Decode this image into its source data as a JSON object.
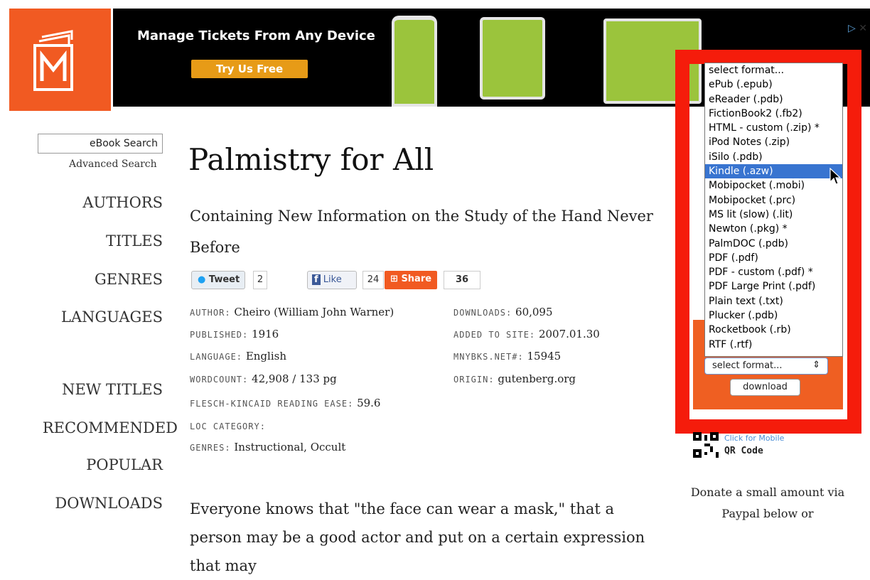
{
  "ad": {
    "title": "Manage Tickets From Any Device",
    "cta": "Try Us Free",
    "choices_label": "▷",
    "close_label": "✕"
  },
  "sidebar": {
    "search_placeholder": "eBook Search",
    "advanced_search": "Advanced Search",
    "nav": [
      "AUTHORS",
      "TITLES",
      "GENRES",
      "LANGUAGES",
      "NEW TITLES",
      "RECOMMENDED",
      "POPULAR",
      "DOWNLOADS"
    ]
  },
  "book": {
    "title": "Palmistry for All",
    "subtitle": "Containing New Information on the Study of the Hand Never Before",
    "social": {
      "tweet_label": "Tweet",
      "tweet_count": "2",
      "like_label": "Like",
      "like_count": "24",
      "share_label": "Share",
      "share_count": "36"
    },
    "meta_left": [
      {
        "key": "AUTHOR:",
        "value": "Cheiro (William John Warner)"
      },
      {
        "key": "PUBLISHED:",
        "value": "1916"
      },
      {
        "key": "LANGUAGE:",
        "value": "English"
      },
      {
        "key": "WORDCOUNT:",
        "value": "42,908 / 133 pg"
      },
      {
        "key": "FLESCH-KINCAID READING EASE:",
        "value": "59.6"
      },
      {
        "key": "LOC CATEGORY:",
        "value": ""
      },
      {
        "key": "GENRES:",
        "value": "Instructional, Occult"
      }
    ],
    "meta_right": [
      {
        "key": "DOWNLOADS:",
        "value": "60,095"
      },
      {
        "key": "ADDED TO SITE:",
        "value": "2007.01.30"
      },
      {
        "key": "MNYBKS.NET#:",
        "value": "15945"
      },
      {
        "key": "ORIGIN:",
        "value": "gutenberg.org"
      }
    ],
    "paragraph": "Everyone knows that \"the face can wear a mask,\" that a person may be a good actor and put on a certain expression that may"
  },
  "download": {
    "formats": [
      "select format...",
      "ePub (.epub)",
      "eReader (.pdb)",
      "FictionBook2 (.fb2)",
      "HTML - custom (.zip) *",
      "iPod Notes (.zip)",
      "iSilo (.pdb)",
      "Kindle (.azw)",
      "Mobipocket (.mobi)",
      "Mobipocket (.prc)",
      "MS lit (slow) (.lit)",
      "Newton (.pkg) *",
      "PalmDOC (.pdb)",
      "PDF (.pdf)",
      "PDF - custom (.pdf) *",
      "PDF Large Print (.pdf)",
      "Plain text (.txt)",
      "Plucker (.pdb)",
      "Rocketbook (.rb)",
      "RTF (.rtf)"
    ],
    "highlighted_index": 7,
    "selected_value": "select format...",
    "button_label": "download"
  },
  "qr": {
    "link": "Click for Mobile",
    "label": "QR Code"
  },
  "donate": {
    "text": "Donate a small amount via Paypal below or"
  },
  "colors": {
    "brand_orange": "#f15a22",
    "highlight_red": "#f51c0b",
    "selection_blue": "#3874d0"
  }
}
